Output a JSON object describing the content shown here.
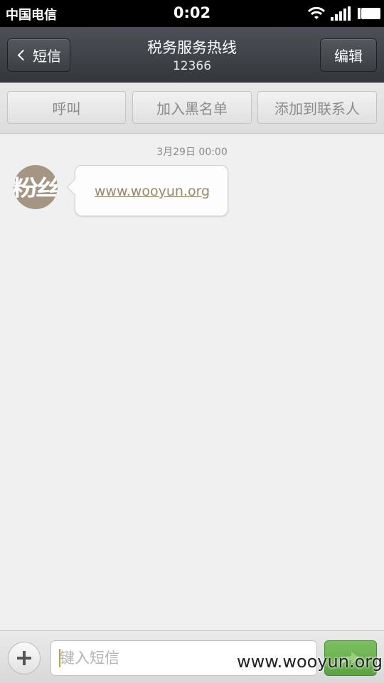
{
  "status_bar": {
    "carrier": "中国电信",
    "time": "0:02"
  },
  "nav": {
    "back_label": "短信",
    "title": "税务服务热线",
    "subtitle": "12366",
    "edit_label": "编辑"
  },
  "actions": {
    "call_label": "呼叫",
    "block_label": "加入黑名单",
    "add_contact_label": "添加到联系人"
  },
  "conversation": {
    "timestamp": "3月29日 00:00",
    "avatar_text": "粉丝",
    "messages": [
      {
        "text": "www.wooyun.org",
        "direction": "incoming",
        "is_link": true
      }
    ]
  },
  "composer": {
    "placeholder": "键入短信",
    "value": ""
  },
  "watermark": "www.wooyun.org",
  "colors": {
    "nav_bg": "#3f4247",
    "link": "#9c8466",
    "send_green": "#6bb350"
  }
}
